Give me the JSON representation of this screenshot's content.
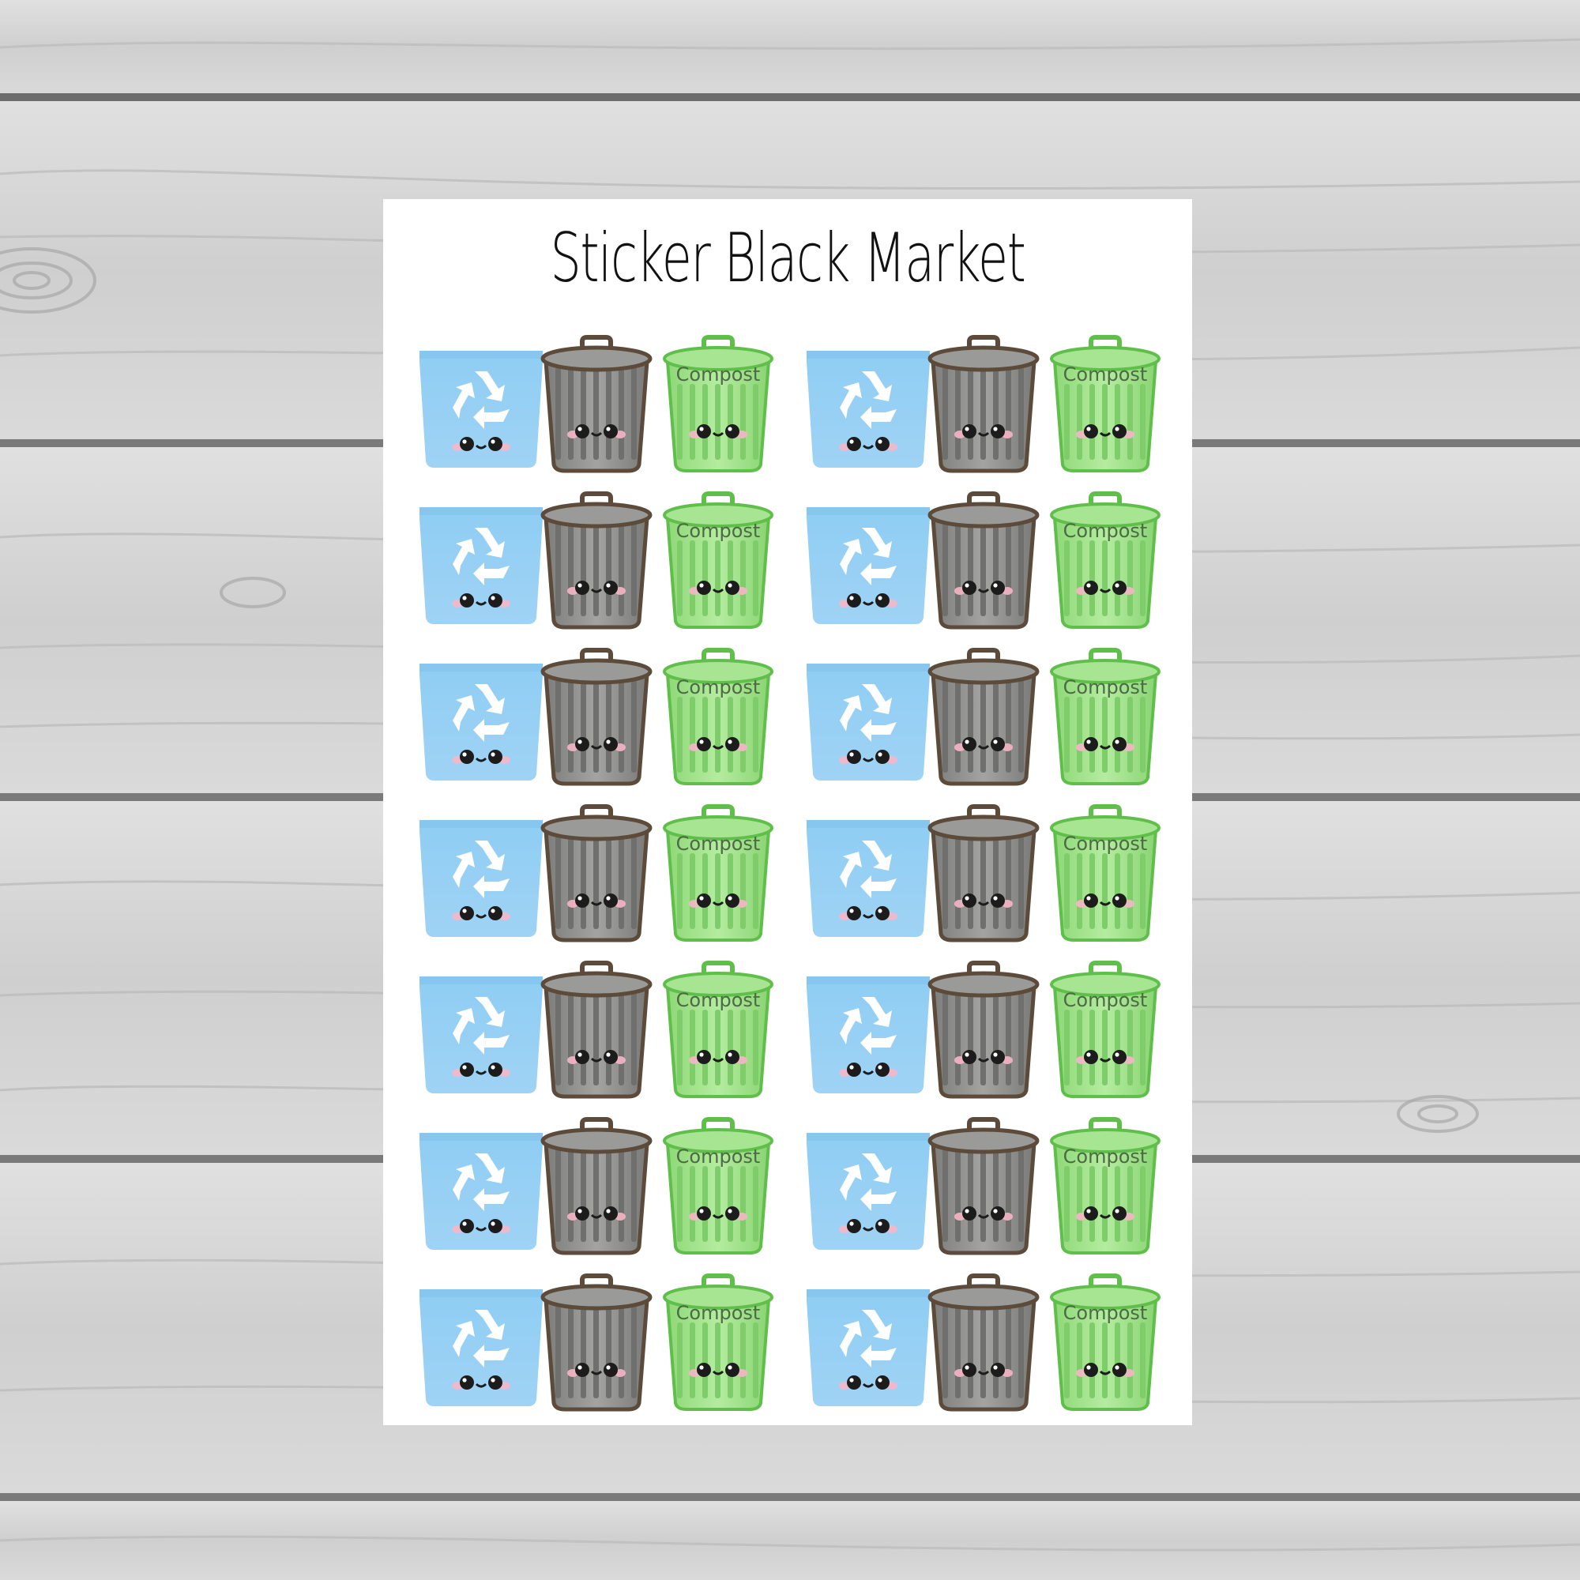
{
  "sheet": {
    "title": "Sticker Black Market",
    "compost_label": "Compost",
    "rows": [
      [
        "recycle-bin",
        "trash-can",
        "compost-bin",
        "recycle-bin",
        "trash-can",
        "compost-bin"
      ],
      [
        "recycle-bin",
        "trash-can",
        "compost-bin",
        "recycle-bin",
        "trash-can",
        "compost-bin"
      ],
      [
        "recycle-bin",
        "trash-can",
        "compost-bin",
        "recycle-bin",
        "trash-can",
        "compost-bin"
      ],
      [
        "recycle-bin",
        "trash-can",
        "compost-bin",
        "recycle-bin",
        "trash-can",
        "compost-bin"
      ],
      [
        "recycle-bin",
        "trash-can",
        "compost-bin",
        "recycle-bin",
        "trash-can",
        "compost-bin"
      ],
      [
        "recycle-bin",
        "trash-can",
        "compost-bin",
        "recycle-bin",
        "trash-can",
        "compost-bin"
      ],
      [
        "recycle-bin",
        "trash-can",
        "compost-bin",
        "recycle-bin",
        "trash-can",
        "compost-bin"
      ]
    ]
  },
  "colors": {
    "recycle_bin": "#9fd3f5",
    "trash_can": "#8c8c8a",
    "compost_bin": "#9be085",
    "sheet": "#ffffff",
    "wood": "#d4d4d4"
  }
}
